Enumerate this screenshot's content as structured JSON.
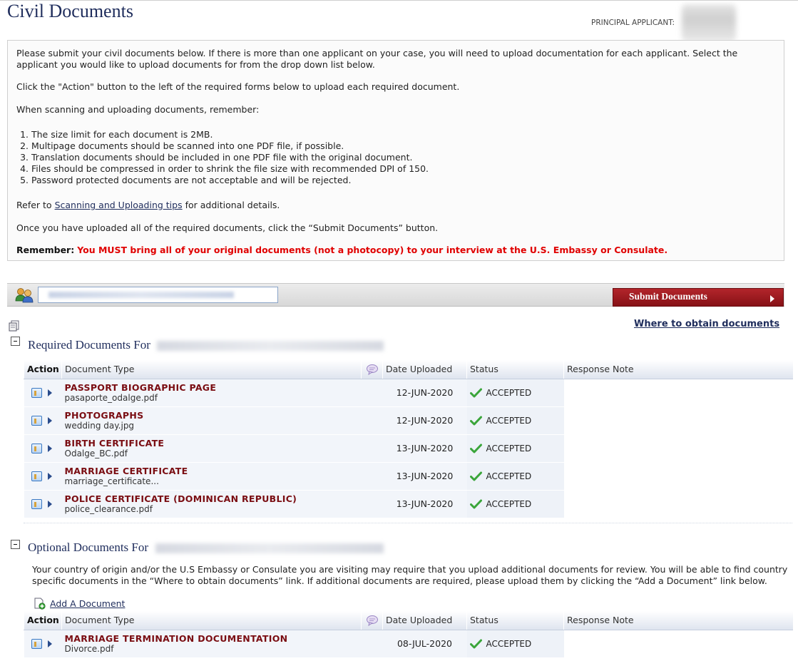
{
  "page": {
    "title": "Civil Documents",
    "principal_label": "PRINCIPAL APPLICANT:"
  },
  "instructions": {
    "intro": "Please submit your civil documents below. If there is more than one applicant on your case, you will need to upload documentation for each applicant. Select the applicant you would like to upload documents for from the drop down list below.",
    "action_hint": "Click the \"Action\" button to the left of the required forms below to upload each required document.",
    "remember_intro": "When scanning and uploading documents, remember:",
    "list": [
      "The size limit for each document is 2MB.",
      "Multipage documents should be scanned into one PDF file, if possible.",
      "Translation documents should be included in one PDF file with the original document.",
      "Files should be compressed in order to shrink the file size with recommended DPI of 150.",
      "Password protected documents are not acceptable and will be rejected."
    ],
    "refer_prefix": "Refer to",
    "refer_link": "Scanning and Uploading tips",
    "refer_suffix": "for additional details.",
    "once_uploaded": "Once you have uploaded all of the required documents, click the “Submit Documents” button.",
    "remember_label": "Remember:",
    "remember_text": "You MUST bring all of your original documents (not a photocopy) to your interview at the U.S. Embassy or Consulate."
  },
  "toolbar": {
    "submit_label": "Submit Documents",
    "where_link": "Where to obtain documents"
  },
  "required": {
    "title": "Required Documents For",
    "columns": {
      "action": "Action",
      "type": "Document Type",
      "date": "Date Uploaded",
      "status": "Status",
      "note": "Response Note"
    },
    "rows": [
      {
        "name": "PASSPORT BIOGRAPHIC PAGE",
        "file": "pasaporte_odalge.pdf",
        "date": "12-JUN-2020",
        "status": "ACCEPTED"
      },
      {
        "name": "PHOTOGRAPHS",
        "file": "wedding day.jpg",
        "date": "12-JUN-2020",
        "status": "ACCEPTED"
      },
      {
        "name": "BIRTH CERTIFICATE",
        "file": "Odalge_BC.pdf",
        "date": "13-JUN-2020",
        "status": "ACCEPTED"
      },
      {
        "name": "MARRIAGE CERTIFICATE",
        "file": "marriage_certificate...",
        "date": "13-JUN-2020",
        "status": "ACCEPTED"
      },
      {
        "name": "POLICE CERTIFICATE (DOMINICAN REPUBLIC)",
        "file": "police_clearance.pdf",
        "date": "13-JUN-2020",
        "status": "ACCEPTED"
      }
    ]
  },
  "optional": {
    "title": "Optional Documents For",
    "description": "Your country of origin and/or the U.S Embassy or Consulate you are visiting may require that you upload additional documents for review. You will be able to find country specific documents in the “Where to obtain documents” link. If additional documents are required, please upload them by clicking the “Add a Document” link below.",
    "add_link": "Add A Document",
    "columns": {
      "action": "Action",
      "type": "Document Type",
      "date": "Date Uploaded",
      "status": "Status",
      "note": "Response Note"
    },
    "rows": [
      {
        "name": "MARRIAGE TERMINATION DOCUMENTATION",
        "file": "Divorce.pdf",
        "date": "08-JUL-2020",
        "status": "ACCEPTED"
      }
    ]
  },
  "colors": {
    "title_navy": "#1f2d5c",
    "doc_type_maroon": "#7a0d12",
    "remember_red": "#e00000",
    "submit_red": "#9b1a20",
    "check_green": "#3aa53a"
  },
  "icons": {
    "applicant": "users-icon",
    "doc_action": "form-icon",
    "status": "check-icon",
    "note_header": "speech-bubble-icon",
    "add": "add-document-icon"
  }
}
